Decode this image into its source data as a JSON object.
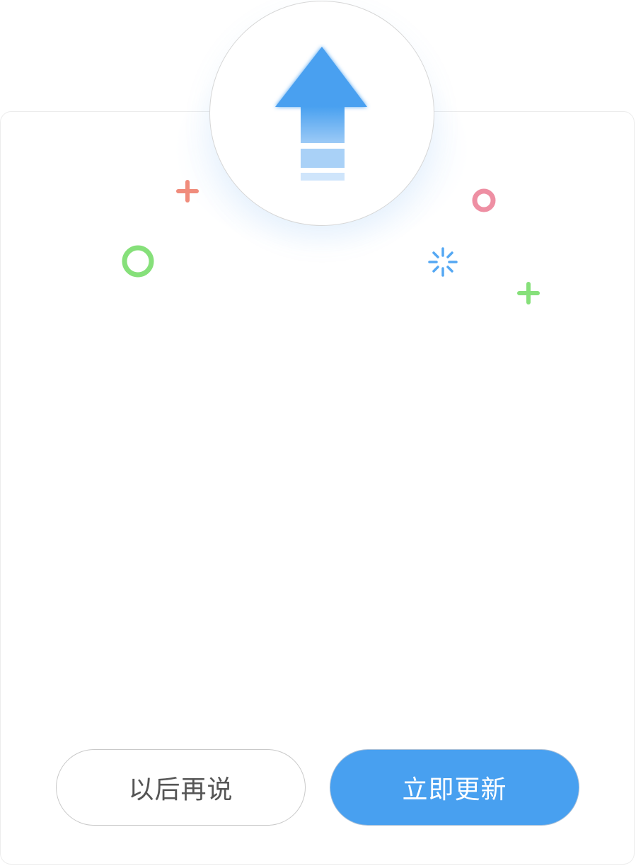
{
  "dialog": {
    "icon": "upload-arrow-icon",
    "accent_color": "#48a0f0",
    "decorations": [
      {
        "name": "plus-icon",
        "color": "#f08c7c"
      },
      {
        "name": "ring-icon",
        "color": "#86e07a"
      },
      {
        "name": "ring-icon",
        "color": "#ee8fa3"
      },
      {
        "name": "sparkle-icon",
        "color": "#55a8f3"
      },
      {
        "name": "plus-icon",
        "color": "#86e07a"
      }
    ]
  },
  "buttons": {
    "later_label": "以后再说",
    "update_label": "立即更新"
  }
}
